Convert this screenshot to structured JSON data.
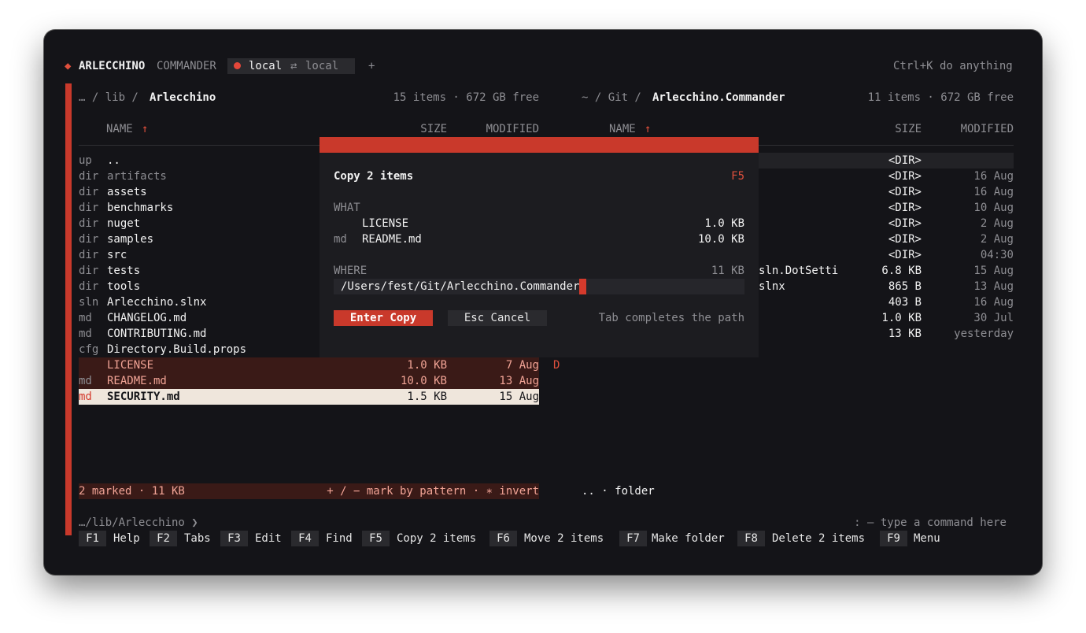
{
  "title": {
    "diamond": "◆",
    "app_bold": "ARLECCHINO",
    "app_rest": "COMMANDER",
    "tab_left": "local",
    "tab_swap": "⇄",
    "tab_right": "local",
    "add_tab": "+",
    "hint": "Ctrl+K do anything"
  },
  "left_panel": {
    "path_prefix": "… / lib / ",
    "path_current": "Arlecchino",
    "summary": "15 items · 672 GB free",
    "col_name": "NAME",
    "sort_arrow": "↑",
    "col_size": "SIZE",
    "col_modified": "MODIFIED",
    "rows": [
      {
        "type": "up",
        "name": "..",
        "size": "",
        "modified": ""
      },
      {
        "type": "dir",
        "name": "artifacts",
        "size": "",
        "modified": ""
      },
      {
        "type": "dir",
        "name": "assets",
        "size": "",
        "modified": ""
      },
      {
        "type": "dir",
        "name": "benchmarks",
        "size": "",
        "modified": ""
      },
      {
        "type": "dir",
        "name": "nuget",
        "size": "",
        "modified": ""
      },
      {
        "type": "dir",
        "name": "samples",
        "size": "",
        "modified": ""
      },
      {
        "type": "dir",
        "name": "src",
        "size": "",
        "modified": ""
      },
      {
        "type": "dir",
        "name": "tests",
        "size": "",
        "modified": ""
      },
      {
        "type": "dir",
        "name": "tools",
        "size": "",
        "modified": ""
      },
      {
        "type": "sln",
        "name": "Arlecchino.slnx",
        "size": "",
        "modified": ""
      },
      {
        "type": "md",
        "name": "CHANGELOG.md",
        "size": "",
        "modified": ""
      },
      {
        "type": "md",
        "name": "CONTRIBUTING.md",
        "size": "",
        "modified": ""
      },
      {
        "type": "cfg",
        "name": "Directory.Build.props",
        "size": "",
        "modified": ""
      },
      {
        "type": "",
        "name": "LICENSE",
        "size": "1.0 KB",
        "modified": "7 Aug"
      },
      {
        "type": "md",
        "name": "README.md",
        "size": "10.0 KB",
        "modified": "13 Aug"
      },
      {
        "type": "md",
        "name": "SECURITY.md",
        "size": "1.5 KB",
        "modified": "15 Aug"
      }
    ],
    "status_marked": "2 marked · 11 KB",
    "status_hint": "+ / − mark by pattern · ∗ invert"
  },
  "right_panel": {
    "path_prefix": "~ / Git / ",
    "path_current": "Arlecchino.Commander",
    "summary": "11 items · 672 GB free",
    "col_name": "NAME",
    "sort_arrow": "↑",
    "col_size": "SIZE",
    "col_modified": "MODIFIED",
    "rows": [
      {
        "name": "",
        "size": "<DIR>",
        "modified": ""
      },
      {
        "name": "",
        "size": "<DIR>",
        "modified": "16 Aug"
      },
      {
        "name": "",
        "size": "<DIR>",
        "modified": "16 Aug"
      },
      {
        "name": "",
        "size": "<DIR>",
        "modified": "10 Aug"
      },
      {
        "name": "",
        "size": "<DIR>",
        "modified": "2 Aug"
      },
      {
        "name": "",
        "size": "<DIR>",
        "modified": "2 Aug"
      },
      {
        "name": "",
        "size": "<DIR>",
        "modified": "04:30"
      },
      {
        "name": "sln.DotSetti",
        "size": "6.8 KB",
        "modified": "15 Aug"
      },
      {
        "name": "slnx",
        "size": "865 B",
        "modified": "13 Aug"
      },
      {
        "name": "",
        "size": "403 B",
        "modified": "16 Aug"
      },
      {
        "name": "",
        "size": "1.0 KB",
        "modified": "30 Jul"
      },
      {
        "name": "",
        "size": "13 KB",
        "modified": "yesterday"
      }
    ],
    "status_hint": ".. · folder"
  },
  "dialog": {
    "title": "Copy 2 items",
    "key": "F5",
    "what_label": "WHAT",
    "items": [
      {
        "type": "",
        "name": "LICENSE",
        "size": "1.0 KB"
      },
      {
        "type": "md",
        "name": "README.md",
        "size": "10.0 KB"
      }
    ],
    "where_label": "WHERE",
    "total": "11 KB",
    "destination": "/Users/fest/Git/Arlecchino.Commander",
    "enter_label": "Enter Copy",
    "esc_label": "Esc Cancel",
    "tab_hint": "Tab completes the path"
  },
  "drop_marker": "D",
  "command_line": {
    "path": "…/lib/Arlecchino ❯",
    "hint": ": — type a command here"
  },
  "fkeys": [
    {
      "key": "F1",
      "label": "Help"
    },
    {
      "key": "F2",
      "label": "Tabs"
    },
    {
      "key": "F3",
      "label": "Edit"
    },
    {
      "key": "F4",
      "label": "Find"
    },
    {
      "key": "F5",
      "label": "Copy 2 items"
    },
    {
      "key": "F6",
      "label": "Move 2 items"
    },
    {
      "key": "F7",
      "label": "Make folder"
    },
    {
      "key": "F8",
      "label": "Delete 2 items"
    },
    {
      "key": "F9",
      "label": "Menu"
    }
  ],
  "colors": {
    "accent": "#c9392b",
    "marked_bg": "#3a1a17",
    "marked_text": "#f2a496",
    "cursor_bg": "#efe6dc"
  }
}
